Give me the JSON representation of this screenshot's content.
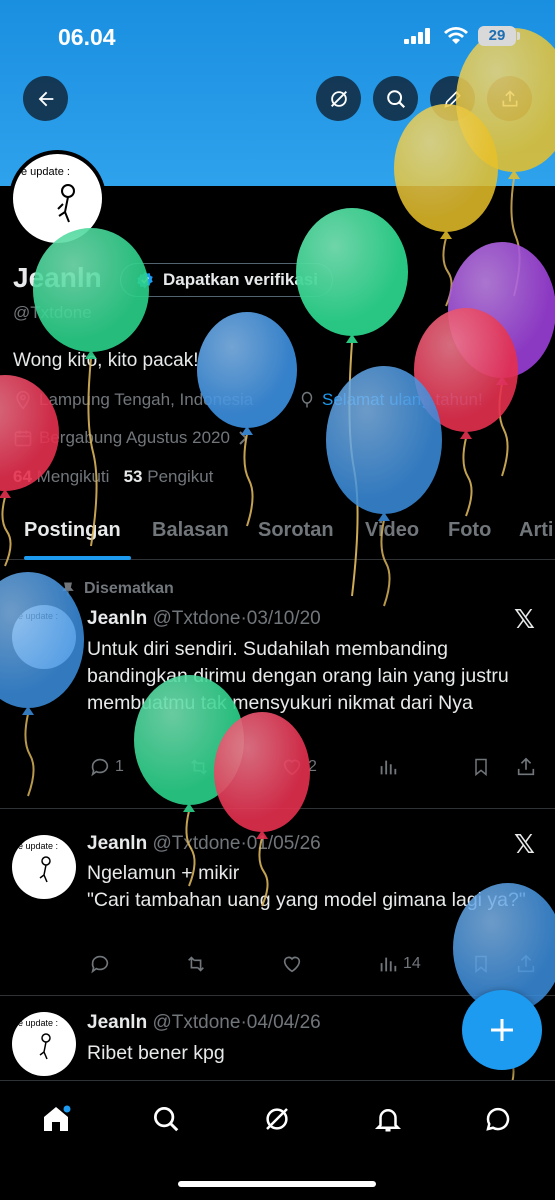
{
  "status_bar": {
    "time": "06.04",
    "battery": "29"
  },
  "profile": {
    "name": "Jeanln",
    "verify_label": "Dapatkan verifikasi",
    "handle": "@Txtdone",
    "bio": "Wong kito, kito pacak!",
    "location": "Lampung Tengah, Indonesia",
    "birthday_link": "Selamat ulang tahun!",
    "joined": "Bergabung Agustus 2020",
    "following_count": "64",
    "following_label": "Mengikuti",
    "followers_count": "53",
    "followers_label": "Pengikut",
    "avatar_caption": "e update :"
  },
  "tabs": [
    "Postingan",
    "Balasan",
    "Sorotan",
    "Video",
    "Foto",
    "Arti"
  ],
  "posts": [
    {
      "pinned_label": "Disematkan",
      "name": "Jeanln",
      "handle": "@Txtdone",
      "date": "03/10/20",
      "text": "Untuk diri sendiri. Sudahilah membanding bandingkan dirimu dengan orang lain yang justru membuatmu tak mensyukuri nikmat dari Nya",
      "replies": "1",
      "likes": "2",
      "views": ""
    },
    {
      "name": "Jeanln",
      "handle": "@Txtdone",
      "date": "01/05/26",
      "text_line1": "Ngelamun + mikir",
      "text_line2": "\"Cari tambahan uang yang model gimana lagi ya?\"",
      "views": "14"
    },
    {
      "name": "Jeanln",
      "handle": "@Txtdone",
      "date": "04/04/26",
      "text": "Ribet bener kpg"
    }
  ],
  "icons": {
    "back": "arrow-left-icon",
    "grok": "grok-icon",
    "search": "search-icon",
    "edit": "pencil-icon",
    "share": "share-icon",
    "home": "home-icon",
    "notifications": "bell-icon",
    "messages": "message-icon",
    "compose": "plus-icon"
  },
  "colors": {
    "accent": "#1d9bf0",
    "banner": "#1a8fe0",
    "muted": "#71767b",
    "background": "#000000"
  },
  "balloon_colors": [
    "#2bd18a",
    "#3b8fe0",
    "#e5304f",
    "#e8c12a",
    "#9b40d8"
  ]
}
